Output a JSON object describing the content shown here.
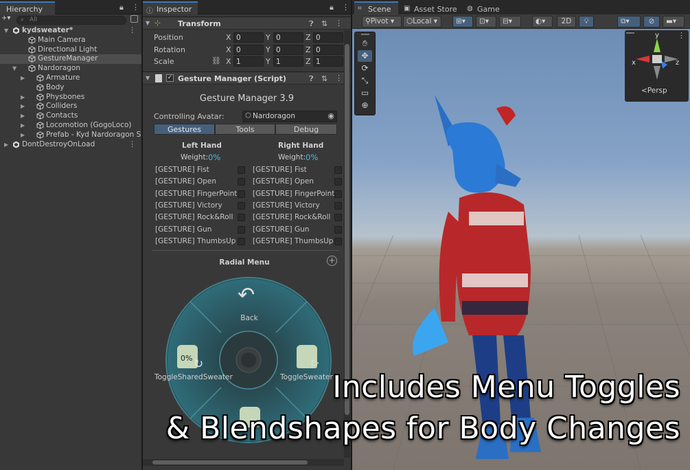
{
  "hierarchy": {
    "tab_label": "Hierarchy",
    "search_placeholder": "All",
    "items": [
      {
        "label": "kydsweater*",
        "depth": 0,
        "expanded": true,
        "scene": true
      },
      {
        "label": "Main Camera",
        "depth": 1
      },
      {
        "label": "Directional Light",
        "depth": 1
      },
      {
        "label": "GestureManager",
        "depth": 1,
        "selected": true
      },
      {
        "label": "Nardoragon",
        "depth": 1,
        "expanded": true
      },
      {
        "label": "Armature",
        "depth": 2,
        "collapsed": true
      },
      {
        "label": "Body",
        "depth": 2
      },
      {
        "label": "Physbones",
        "depth": 2,
        "collapsed": true
      },
      {
        "label": "Colliders",
        "depth": 2,
        "collapsed": true
      },
      {
        "label": "Contacts",
        "depth": 2,
        "collapsed": true
      },
      {
        "label": "Locomotion (GogoLoco)",
        "depth": 2,
        "collapsed": true
      },
      {
        "label": "Prefab - Kyd Nardoragon Sw",
        "depth": 2,
        "collapsed": true
      },
      {
        "label": "DontDestroyOnLoad",
        "depth": 0,
        "collapsed": true,
        "scene": true
      }
    ]
  },
  "inspector": {
    "tab_label": "Inspector",
    "transform": {
      "title": "Transform",
      "position": {
        "label": "Position",
        "x": "0",
        "y": "0",
        "z": "0"
      },
      "rotation": {
        "label": "Rotation",
        "x": "0",
        "y": "0",
        "z": "0"
      },
      "scale": {
        "label": "Scale",
        "x": "1",
        "y": "1",
        "z": "1"
      },
      "axes": [
        "X",
        "Y",
        "Z"
      ]
    },
    "gesture_manager": {
      "header": "Gesture Manager (Script)",
      "title": "Gesture Manager 3.9",
      "controlling_label": "Controlling Avatar:",
      "controlling_value": "Nardoragon",
      "tabs": [
        "Gestures",
        "Tools",
        "Debug"
      ],
      "left_hand": "Left Hand",
      "right_hand": "Right Hand",
      "weight_label": "Weight:",
      "left_weight": "0%",
      "right_weight": "0%",
      "gestures": [
        "[GESTURE] Fist",
        "[GESTURE] Open",
        "[GESTURE] FingerPoint",
        "[GESTURE] Victory",
        "[GESTURE] Rock&Roll",
        "[GESTURE] Gun",
        "[GESTURE] ThumbsUp"
      ],
      "radial_title": "Radial Menu",
      "radial": {
        "back": "Back",
        "left_item": "ToggleSharedSweater",
        "left_value": "0%",
        "right_item": "ToggleSweater"
      }
    }
  },
  "scene": {
    "tabs": [
      "Scene",
      "Asset Store",
      "Game"
    ],
    "toolbar": {
      "pivot": "Pivot",
      "local": "Local",
      "mode2d": "2D"
    },
    "gizmo": {
      "persp": "Persp",
      "x": "x",
      "y": "y",
      "z": "z"
    },
    "overlay_lines": [
      "Includes Menu Toggles",
      "& Blendshapes for Body Changes"
    ]
  },
  "colors": {
    "accent": "#3a79bb",
    "weight": "#4fb7e8",
    "radial": "#2f6c79"
  }
}
